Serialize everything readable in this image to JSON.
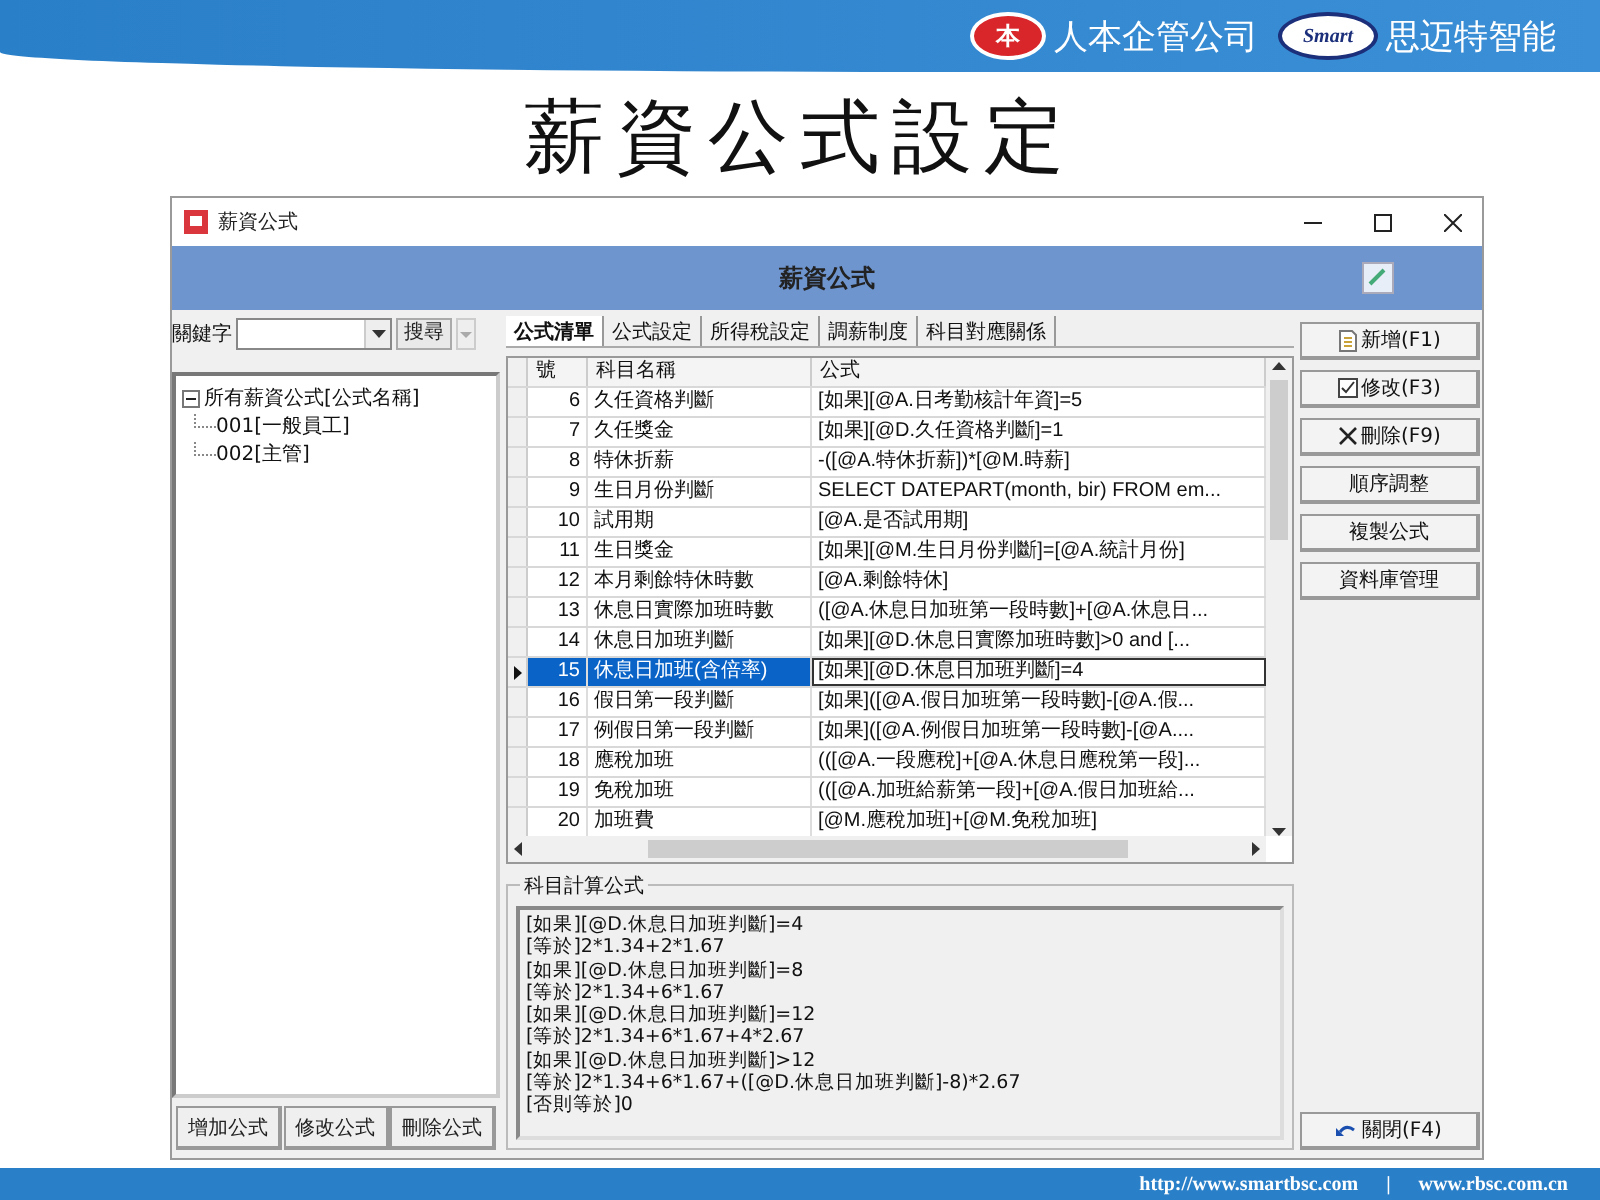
{
  "slide": {
    "logos": [
      {
        "mark": "本",
        "name": "人本企管公司",
        "kind": "round"
      },
      {
        "mark": "Smart",
        "name": "思迈特智能",
        "kind": "swoosh"
      }
    ],
    "title": "薪資公式設定",
    "footer": [
      "http://www.smartbsc.com",
      "|",
      "www.rbsc.com.cn"
    ]
  },
  "window": {
    "title": "薪資公式",
    "header": "薪資公式"
  },
  "search": {
    "label": "關鍵字",
    "button": "搜尋"
  },
  "tree": {
    "label": "所有薪資公式[公式名稱]",
    "expanded": true,
    "children": [
      {
        "label": "001[一般員工]"
      },
      {
        "label": "002[主管]"
      }
    ]
  },
  "left_buttons": [
    "增加公式",
    "修改公式",
    "刪除公式"
  ],
  "tabs": [
    {
      "label": "公式清單",
      "selected": true
    },
    {
      "label": "公式設定",
      "selected": false
    },
    {
      "label": "所得稅設定",
      "selected": false
    },
    {
      "label": "調薪制度",
      "selected": false
    },
    {
      "label": "科目對應關係",
      "selected": false
    }
  ],
  "table": {
    "columns": [
      "號",
      "科目名稱",
      "公式"
    ],
    "rows": [
      {
        "number": "6",
        "name": "久任資格判斷",
        "formula": "[如果][@A.日考勤核計年資]=5",
        "selected": false
      },
      {
        "number": "7",
        "name": "久任獎金",
        "formula": "[如果][@D.久任資格判斷]=1",
        "selected": false
      },
      {
        "number": "8",
        "name": "特休折薪",
        "formula": "-([@A.特休折薪])*[@M.時薪]",
        "selected": false
      },
      {
        "number": "9",
        "name": "生日月份判斷",
        "formula": "SELECT DATEPART(month, bir) FROM em...",
        "selected": false
      },
      {
        "number": "10",
        "name": "試用期",
        "formula": "[@A.是否試用期]",
        "selected": false
      },
      {
        "number": "11",
        "name": "生日獎金",
        "formula": "[如果][@M.生日月份判斷]=[@A.統計月份]",
        "selected": false
      },
      {
        "number": "12",
        "name": "本月剩餘特休時數",
        "formula": "[@A.剩餘特休]",
        "selected": false
      },
      {
        "number": "13",
        "name": "休息日實際加班時數",
        "formula": "([@A.休息日加班第一段時數]+[@A.休息日...",
        "selected": false
      },
      {
        "number": "14",
        "name": "休息日加班判斷",
        "formula": "[如果][@D.休息日實際加班時數]>0 and [...",
        "selected": false
      },
      {
        "number": "15",
        "name": "休息日加班(含倍率)",
        "formula": "[如果][@D.休息日加班判斷]=4",
        "selected": true
      },
      {
        "number": "16",
        "name": "假日第一段判斷",
        "formula": "[如果]([@A.假日加班第一段時數]-[@A.假...",
        "selected": false
      },
      {
        "number": "17",
        "name": "例假日第一段判斷",
        "formula": "[如果]([@A.例假日加班第一段時數]-[@A....",
        "selected": false
      },
      {
        "number": "18",
        "name": "應稅加班",
        "formula": "(([@A.一段應稅]+[@A.休息日應稅第一段]...",
        "selected": false
      },
      {
        "number": "19",
        "name": "免稅加班",
        "formula": "(([@A.加班給薪第一段]+[@A.假日加班給...",
        "selected": false
      },
      {
        "number": "20",
        "name": "加班費",
        "formula": "[@M.應稅加班]+[@M.免稅加班]",
        "selected": false
      }
    ]
  },
  "formula_box": {
    "title": "科目計算公式",
    "lines": [
      "[如果][@D.休息日加班判斷]=4",
      "[等於]2*1.34+2*1.67",
      "[如果][@D.休息日加班判斷]=8",
      "[等於]2*1.34+6*1.67",
      "[如果][@D.休息日加班判斷]=12",
      "[等於]2*1.34+6*1.67+4*2.67",
      "[如果][@D.休息日加班判斷]>12",
      "[等於]2*1.34+6*1.67+([@D.休息日加班判斷]-8)*2.67",
      "[否則等於]0"
    ]
  },
  "actions": [
    {
      "label": "新增(F1)",
      "kind": "new"
    },
    {
      "label": "修改(F3)",
      "kind": "edit"
    },
    {
      "label": "刪除(F9)",
      "kind": "delete"
    },
    {
      "label": "順序調整",
      "kind": "plain"
    },
    {
      "label": "複製公式",
      "kind": "plain"
    },
    {
      "label": "資料庫管理",
      "kind": "plain"
    },
    {
      "label": "關閉(F4)",
      "kind": "close"
    }
  ]
}
